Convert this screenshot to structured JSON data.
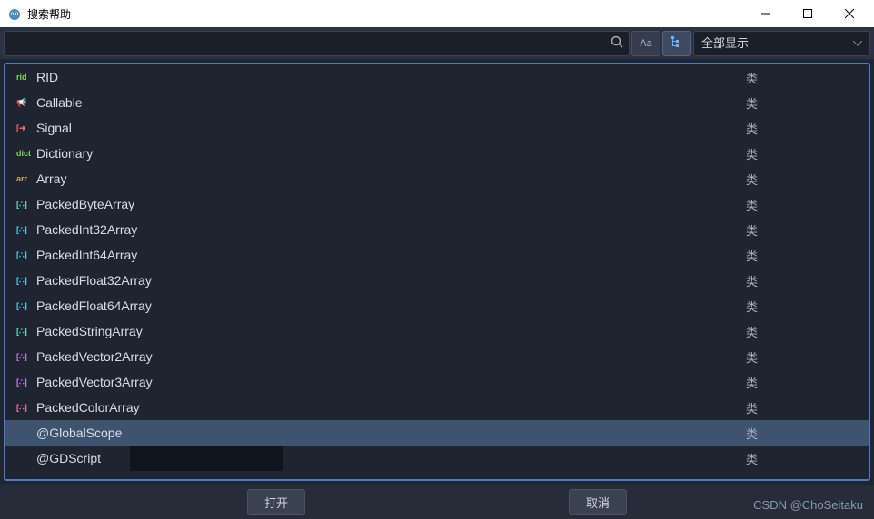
{
  "window": {
    "title": "搜索帮助"
  },
  "toolbar": {
    "filter_label": "全部显示",
    "search_value": ""
  },
  "type_label": "类",
  "items": [
    {
      "name": "RID",
      "icon": "rid",
      "icon_class": "ico-rid",
      "selected": false,
      "dark": false
    },
    {
      "name": "Callable",
      "icon": "📢",
      "icon_class": "ico-call",
      "selected": false,
      "dark": false
    },
    {
      "name": "Signal",
      "icon": "[➜",
      "icon_class": "ico-sig",
      "selected": false,
      "dark": false
    },
    {
      "name": "Dictionary",
      "icon": "dict",
      "icon_class": "ico-dict",
      "selected": false,
      "dark": false
    },
    {
      "name": "Array",
      "icon": "arr",
      "icon_class": "ico-arr",
      "selected": false,
      "dark": false
    },
    {
      "name": "PackedByteArray",
      "icon": "[∴]",
      "icon_class": "ico-pack-b",
      "selected": false,
      "dark": false
    },
    {
      "name": "PackedInt32Array",
      "icon": "[∴]",
      "icon_class": "ico-pack-i",
      "selected": false,
      "dark": false
    },
    {
      "name": "PackedInt64Array",
      "icon": "[∴]",
      "icon_class": "ico-pack-i",
      "selected": false,
      "dark": false
    },
    {
      "name": "PackedFloat32Array",
      "icon": "[∴]",
      "icon_class": "ico-pack-f",
      "selected": false,
      "dark": false
    },
    {
      "name": "PackedFloat64Array",
      "icon": "[∴]",
      "icon_class": "ico-pack-f",
      "selected": false,
      "dark": false
    },
    {
      "name": "PackedStringArray",
      "icon": "[∴]",
      "icon_class": "ico-pack-s",
      "selected": false,
      "dark": false
    },
    {
      "name": "PackedVector2Array",
      "icon": "[∴]",
      "icon_class": "ico-pack-v",
      "selected": false,
      "dark": false
    },
    {
      "name": "PackedVector3Array",
      "icon": "[∴]",
      "icon_class": "ico-pack-v",
      "selected": false,
      "dark": false
    },
    {
      "name": "PackedColorArray",
      "icon": "[∴]",
      "icon_class": "ico-pack-c",
      "selected": false,
      "dark": false
    },
    {
      "name": "@GlobalScope",
      "icon": "",
      "icon_class": "",
      "selected": true,
      "dark": false
    },
    {
      "name": "@GDScript",
      "icon": "",
      "icon_class": "",
      "selected": false,
      "dark": true
    }
  ],
  "footer": {
    "open": "打开",
    "cancel": "取消"
  },
  "watermark": "CSDN @ChoSeitaku"
}
